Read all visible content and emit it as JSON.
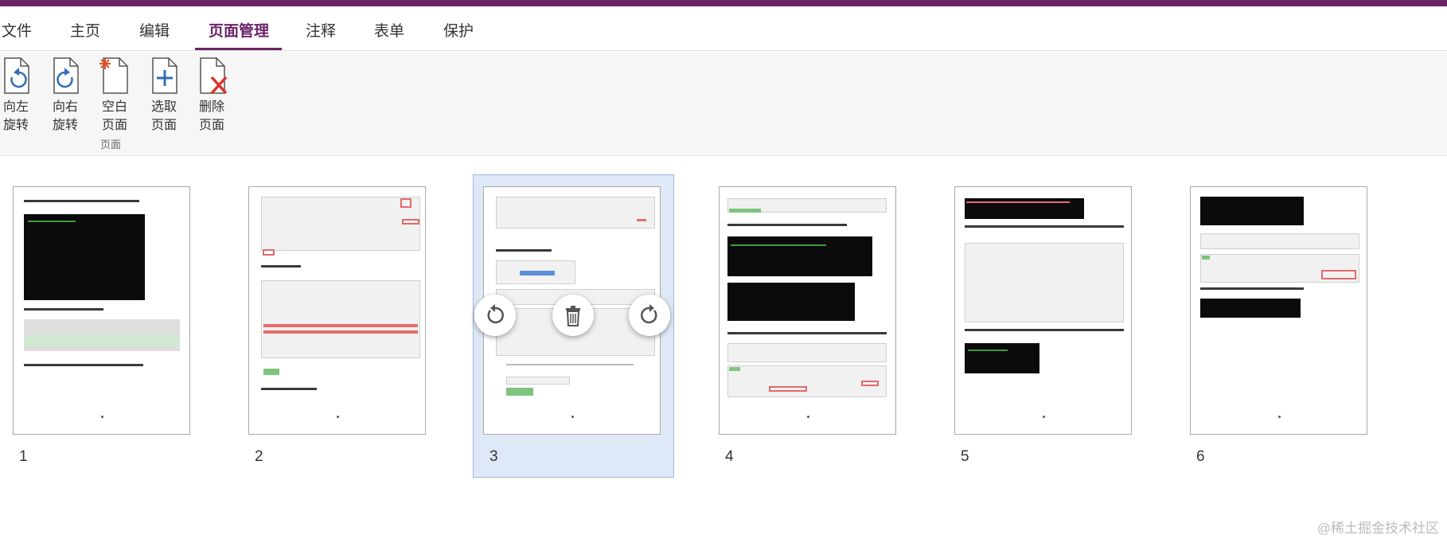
{
  "menu": {
    "tabs": [
      {
        "label": "文件"
      },
      {
        "label": "主页"
      },
      {
        "label": "编辑"
      },
      {
        "label": "页面管理"
      },
      {
        "label": "注释"
      },
      {
        "label": "表单"
      },
      {
        "label": "保护"
      }
    ],
    "active_tab": "页面管理"
  },
  "ribbon": {
    "buttons": [
      {
        "line1": "向左",
        "line2": "旋转",
        "icon": "rotate-left-icon"
      },
      {
        "line1": "向右",
        "line2": "旋转",
        "icon": "rotate-right-icon"
      },
      {
        "line1": "空白",
        "line2": "页面",
        "icon": "blank-page-icon"
      },
      {
        "line1": "选取",
        "line2": "页面",
        "icon": "insert-page-icon"
      },
      {
        "line1": "删除",
        "line2": "页面",
        "icon": "delete-page-icon"
      }
    ],
    "group_label": "页面"
  },
  "pages": [
    {
      "number": "1"
    },
    {
      "number": "2"
    },
    {
      "number": "3"
    },
    {
      "number": "4"
    },
    {
      "number": "5"
    },
    {
      "number": "6"
    }
  ],
  "selected_page": "3",
  "page_actions": [
    {
      "icon": "rotate-left-icon"
    },
    {
      "icon": "trash-icon"
    },
    {
      "icon": "rotate-right-icon"
    }
  ],
  "watermark": "@稀土掘金技术社区",
  "colors": {
    "accent": "#6b2367",
    "selection": "#dfe8f6"
  }
}
